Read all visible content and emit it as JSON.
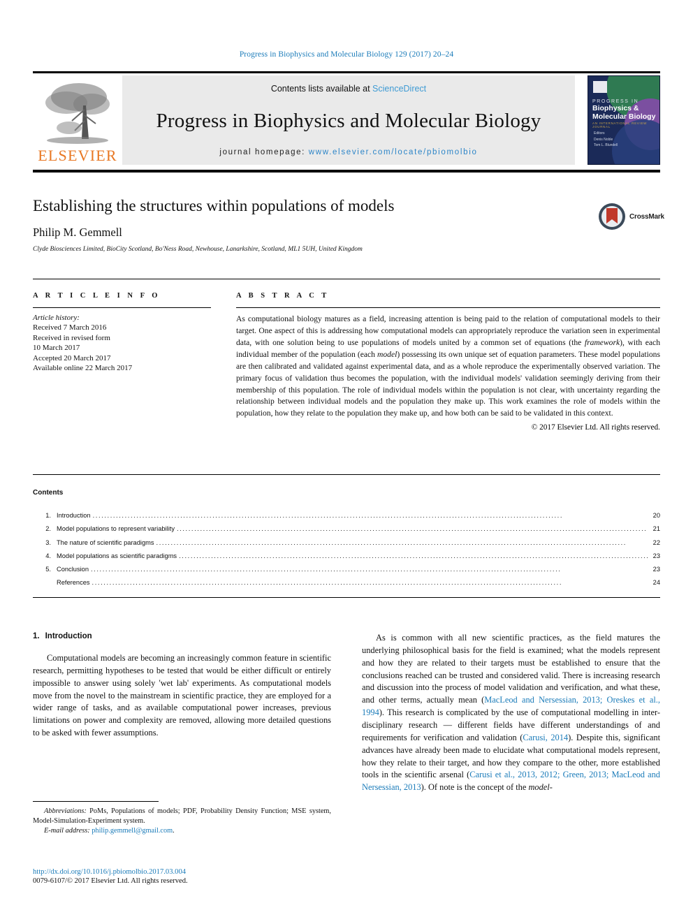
{
  "running_head": "Progress in Biophysics and Molecular Biology 129 (2017) 20–24",
  "masthead": {
    "publisher_wordmark": "ELSEVIER",
    "contents_prefix": "Contents lists available at ",
    "sciencedirect_link": "ScienceDirect",
    "journal_title": "Progress in Biophysics and Molecular Biology",
    "homepage_prefix": "journal homepage: ",
    "homepage_link": "www.elsevier.com/locate/pbiomolbio",
    "cover": {
      "line1": "PROGRESS IN",
      "line2": "Biophysics &",
      "line3": "Molecular Biology",
      "line4": "AN INTERNATIONAL REVIEW JOURNAL",
      "editors_label": "Editors",
      "editor1": "Denis Noble",
      "editor2": "Tom L. Blundell"
    }
  },
  "article": {
    "title": "Establishing the structures within populations of models",
    "author": "Philip M. Gemmell",
    "affiliation": "Clyde Biosciences Limited, BioCity Scotland, Bo'Ness Road, Newhouse, Lanarkshire, Scotland, ML1 5UH, United Kingdom",
    "crossmark_label": "CrossMark"
  },
  "info": {
    "heading": "A R T I C L E  I N F O",
    "history_label": "Article history:",
    "history": [
      "Received 7 March 2016",
      "Received in revised form",
      "10 March 2017",
      "Accepted 20 March 2017",
      "Available online 22 March 2017"
    ]
  },
  "abstract": {
    "heading": "A B S T R A C T",
    "part1": "As computational biology matures as a field, increasing attention is being paid to the relation of computational models to their target. One aspect of this is addressing how computational models can appropriately reproduce the variation seen in experimental data, with one solution being to use populations of models united by a common set of equations (the ",
    "italic1": "framework",
    "part2": "), with each individual member of the population (each ",
    "italic2": "model",
    "part3": ") possessing its own unique set of equation parameters. These model populations are then calibrated and validated against experimental data, and as a whole reproduce the experimentally observed variation. The primary focus of validation thus becomes the population, with the individual models' validation seemingly deriving from their membership of this population. The role of individual models within the population is not clear, with uncertainty regarding the relationship between individual models and the population they make up. This work examines the role of models within the population, how they relate to the population they make up, and how both can be said to be validated in this context.",
    "copyright": "© 2017 Elsevier Ltd. All rights reserved."
  },
  "contents": {
    "label": "Contents",
    "items": [
      {
        "num": "1.",
        "label": "Introduction",
        "page": "20"
      },
      {
        "num": "2.",
        "label": "Model populations to represent variability",
        "page": "21"
      },
      {
        "num": "3.",
        "label": "The nature of scientific paradigms",
        "page": "22"
      },
      {
        "num": "4.",
        "label": "Model populations as scientific paradigms",
        "page": "23"
      },
      {
        "num": "5.",
        "label": "Conclusion",
        "page": "23"
      },
      {
        "num": "",
        "label": "References",
        "page": "24"
      }
    ]
  },
  "body": {
    "section_num": "1.",
    "section_title": "Introduction",
    "left_p1": "Computational models are becoming an increasingly common feature in scientific research, permitting hypotheses to be tested that would be either difficult or entirely impossible to answer using solely 'wet lab' experiments. As computational models move from the novel to the mainstream in scientific practice, they are employed for a wider range of tasks, and as available computational power increases, previous limitations on power and complexity are removed, allowing more detailed questions to be asked with fewer assumptions.",
    "right_p1_a": "As is common with all new scientific practices, as the field matures the underlying philosophical basis for the field is examined; what the models represent and how they are related to their targets must be established to ensure that the conclusions reached can be trusted and considered valid. There is increasing research and discussion into the process of model validation and verification, and what these, and other terms, actually mean (",
    "right_cite1": "MacLeod and Nersessian, 2013; Oreskes et al., 1994",
    "right_p1_b": "). This research is complicated by the use of computational modelling in inter-disciplinary research — different fields have different understandings of and requirements for verification and validation (",
    "right_cite2": "Carusi, 2014",
    "right_p1_c": "). Despite this, significant advances have already been made to elucidate what computational models represent, how they relate to their target, and how they compare to the other, more established tools in the scientific arsenal (",
    "right_cite3": "Carusi et al., 2013, 2012; Green, 2013; MacLeod and Nersessian, 2013",
    "right_p1_d": "). Of note is the concept of the ",
    "right_p1_italic_end": "model-"
  },
  "footnotes": {
    "abbrev_label": "Abbreviations:",
    "abbrev_text": " PoMs, Populations of models; PDF, Probability Density Function; MSE system, Model-Simulation-Experiment system.",
    "email_label": "E-mail address:",
    "email": "philip.gemmell@gmail.com",
    "doi": "http://dx.doi.org/10.1016/j.pbiomolbio.2017.03.004",
    "issn": "0079-6107/© 2017 Elsevier Ltd. All rights reserved."
  },
  "colors": {
    "link_blue": "#1a7bb9",
    "sciencedirect_blue": "#3f9bd4",
    "elsevier_orange": "#E87722",
    "crossmark_red": "#c0392b"
  }
}
